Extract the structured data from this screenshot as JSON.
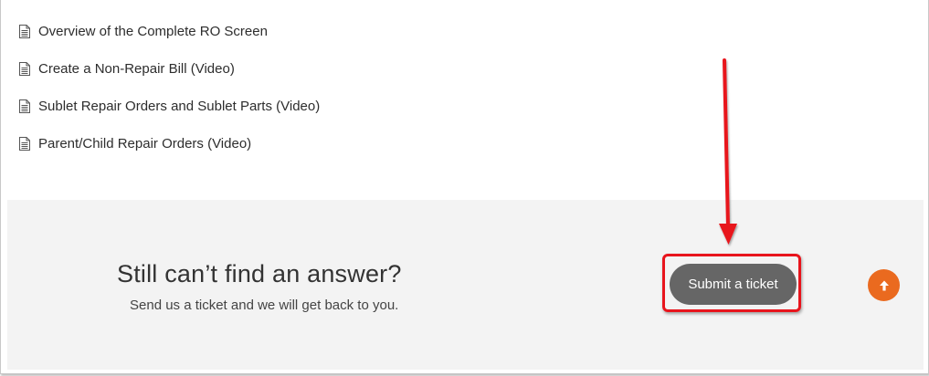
{
  "articles": [
    {
      "label": "Overview of the Complete RO Screen",
      "icon": "document-icon"
    },
    {
      "label": "Create a Non-Repair Bill (Video)",
      "icon": "document-icon"
    },
    {
      "label": "Sublet Repair Orders and Sublet Parts (Video)",
      "icon": "document-icon"
    },
    {
      "label": "Parent/Child Repair Orders (Video)",
      "icon": "document-icon"
    }
  ],
  "footer": {
    "title": "Still can’t find an answer?",
    "subtitle": "Send us a ticket and we will get back to you.",
    "submit_label": "Submit a ticket",
    "scroll_top_icon": "arrow-up-icon"
  },
  "colors": {
    "band_background": "#f3f3f3",
    "button_background": "#666666",
    "scroll_top_background": "#ea6a1f",
    "annotation_red": "#e8141c"
  }
}
